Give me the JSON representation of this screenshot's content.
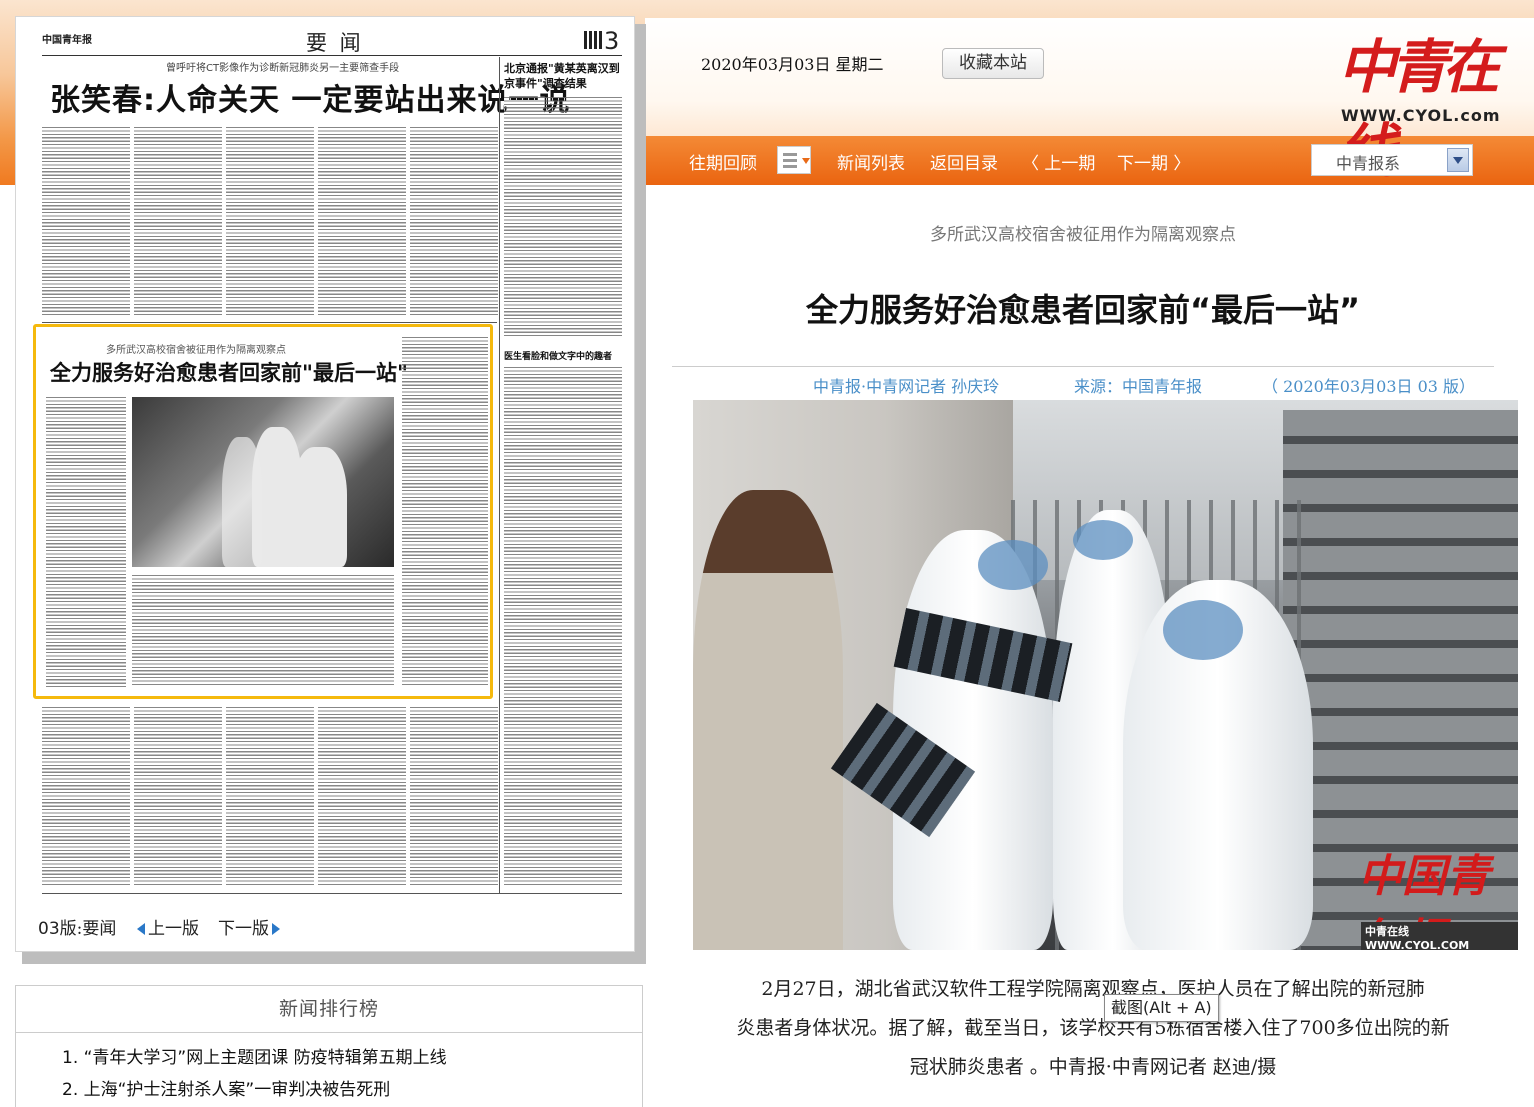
{
  "header": {
    "date": "2020年03月03日  星期二",
    "favorite_button": "收藏本站",
    "logo_text": "中青在线",
    "logo_url": "WWW.CYOL.com"
  },
  "nav": {
    "items": [
      "往期回顾",
      "新闻列表",
      "返回目录",
      "〈 上一期",
      "下一期 〉"
    ],
    "select_value": "中青报系",
    "accent_color": "#ee6a16"
  },
  "paper": {
    "masthead": "中国青年报",
    "section": "要 闻",
    "page_number": "3",
    "kicker": "曾呼吁将CT影像作为诊断新冠肺炎另一主要筛查手段",
    "headline": "张笑春:人命关天 一定要站出来说一说",
    "side_headline": "北京通报\"黄某英离汉到京事件\"调查结果",
    "side_headline2": "医生看脸和做文字中的趣者",
    "highlight_kicker": "多所武汉高校宿舍被征用作为隔离观察点",
    "highlight_headline": "全力服务好治愈患者回家前\"最后一站\"",
    "footer_page": "03",
    "footer_label": "版:要闻",
    "prev_page": "上一版",
    "next_page": "下一版"
  },
  "ranking": {
    "title": "新闻排行榜",
    "items": [
      "1. “青年大学习”网上主题团课 防疫特辑第五期上线",
      "2. 上海“护士注射杀人案”一审判决被告死刑"
    ]
  },
  "article": {
    "kicker": "多所武汉高校宿舍被征用作为隔离观察点",
    "title": "全力服务好治愈患者回家前“最后一站”",
    "author": "中青报·中青网记者 孙庆玲",
    "source": "来源：中国青年报",
    "date_edition": "（ 2020年03月03日    03 版）",
    "photo_watermark": "中国青年报",
    "photo_watermark_url": "中青在线 WWW.CYOL.COM",
    "caption_lines": [
      "2月27日，湖北省武汉软件工程学院隔离观察点，医护人员在了解出院的新冠肺",
      "炎患者身体状况。据了解，截至当日，该学校共有5栋宿舍楼入住了700多位出院的新",
      "冠状肺炎患者 。中青报·中青网记者 赵迪/摄"
    ]
  },
  "tooltip": "截图(Alt + A)"
}
